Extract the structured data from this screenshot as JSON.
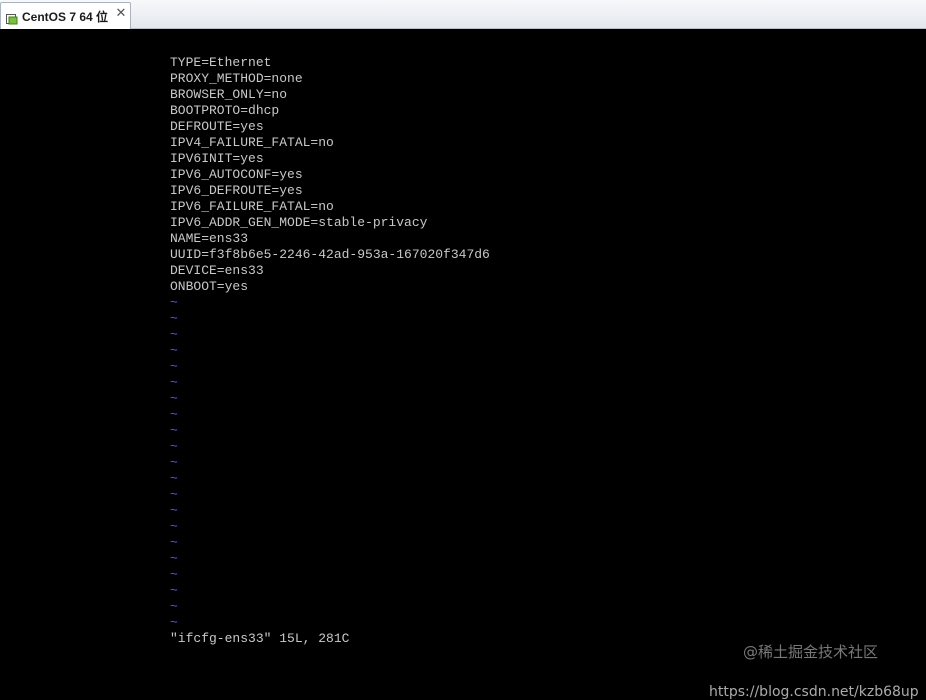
{
  "window": {
    "tab_title": "CentOS 7 64 位",
    "tab_icon": "vm-icon",
    "close_glyph": "✕"
  },
  "file_lines": [
    "TYPE=Ethernet",
    "PROXY_METHOD=none",
    "BROWSER_ONLY=no",
    "BOOTPROTO=dhcp",
    "DEFROUTE=yes",
    "IPV4_FAILURE_FATAL=no",
    "IPV6INIT=yes",
    "IPV6_AUTOCONF=yes",
    "IPV6_DEFROUTE=yes",
    "IPV6_FAILURE_FATAL=no",
    "IPV6_ADDR_GEN_MODE=stable-privacy",
    "NAME=ens33",
    "UUID=f3f8b6e5-2246-42ad-953a-167020f347d6",
    "DEVICE=ens33",
    "ONBOOT=yes"
  ],
  "tilde_glyph": "~",
  "status_line": "\"ifcfg-ens33\" 15L, 281C",
  "watermark": {
    "site": "@稀土掘金技术社区",
    "url": "https://blog.csdn.net/kzb68up"
  },
  "colors": {
    "text": "#c8c8c8",
    "tilde": "#5a5aff",
    "background": "#000000"
  }
}
